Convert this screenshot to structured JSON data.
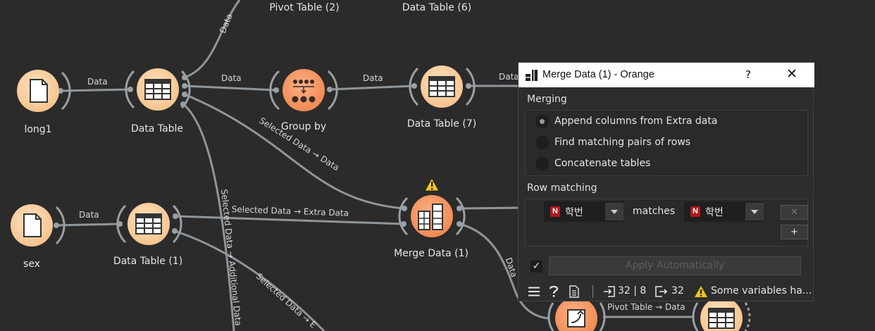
{
  "canvas": {
    "nodes": [
      {
        "name": "node-long1",
        "label": "long1",
        "icon": "file-icon"
      },
      {
        "name": "node-data-table",
        "label": "Data Table",
        "icon": "table-icon"
      },
      {
        "name": "node-group-by",
        "label": "Group by",
        "icon": "group-by-icon"
      },
      {
        "name": "node-data-table-7",
        "label": "Data Table (7)",
        "icon": "table-icon"
      },
      {
        "name": "node-sex",
        "label": "sex",
        "icon": "file-icon"
      },
      {
        "name": "node-data-table-1",
        "label": "Data Table (1)",
        "icon": "table-icon"
      },
      {
        "name": "node-merge-data-1",
        "label": "Merge Data (1)",
        "icon": "merge-icon"
      },
      {
        "name": "node-pivot-table-2",
        "label": "Pivot Table (2)"
      },
      {
        "name": "node-data-table-6",
        "label": "Data Table (6)"
      }
    ],
    "edge_labels": {
      "long1_table": "Data",
      "table_top": "Data",
      "table_groupby": "Data",
      "groupby_table7": "Data",
      "table7_out": "Data",
      "selected_data": "Selected Data → Data",
      "sex_table1": "Data",
      "selected_extra": "Selected Data → Extra Data",
      "selected_additional": "Selected Data → Additional Data",
      "selected_e": "Selected Data → E",
      "merge_out": "Data",
      "pivot_table": "Pivot Table → Data"
    }
  },
  "dialog": {
    "title": "Merge Data (1) - Orange",
    "help": "?",
    "close": "✕",
    "merging_header": "Merging",
    "options": [
      {
        "label": "Append columns from Extra data",
        "selected": true
      },
      {
        "label": "Find matching pairs of rows",
        "selected": false
      },
      {
        "label": "Concatenate tables",
        "selected": false
      }
    ],
    "row_matching_header": "Row matching",
    "left_var": {
      "type": "N",
      "value": "학번"
    },
    "matches": "matches",
    "right_var": {
      "type": "N",
      "value": "학번"
    },
    "remove_btn": "✕",
    "add_btn": "+",
    "apply_checked": "✓",
    "apply_label": "Apply Automatically",
    "status": {
      "input": "32 | 8",
      "output": "32",
      "warning": "Some variables ha..."
    }
  },
  "colors": {
    "background": "#2b2b2b",
    "node_fill": "#fcd6a8",
    "node_fill_active": "#f79c6a",
    "edge": "#8f969b",
    "warning": "#f5c518"
  }
}
